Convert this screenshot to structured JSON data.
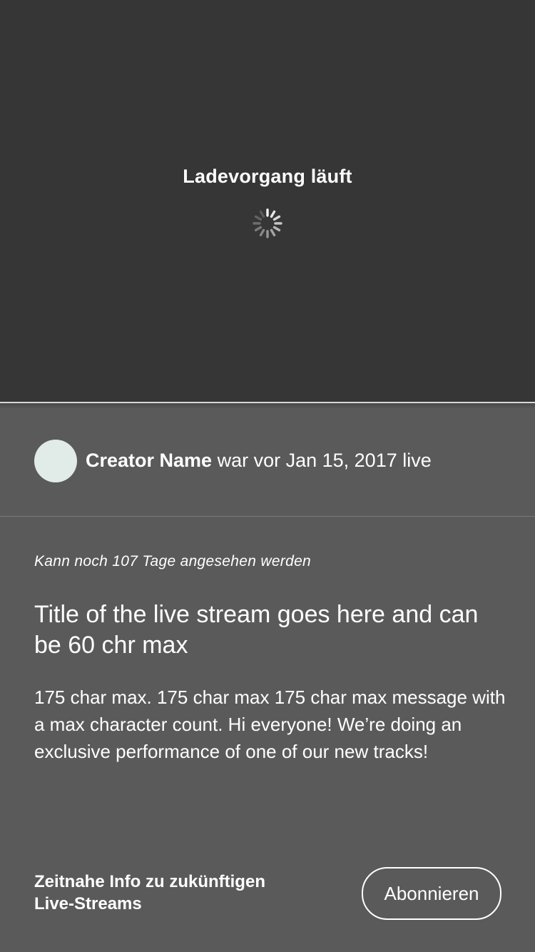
{
  "player": {
    "loading_text": "Ladevorgang läuft",
    "background_color": "#363636",
    "spinner_icon": "loading-spinner-icon"
  },
  "creator": {
    "name": "Creator Name",
    "status_text": " war vor Jan 15, 2017 live",
    "avatar_color": "#e1ebe8"
  },
  "stream": {
    "availability": "Kann noch 107 Tage angesehen werden",
    "title": "Title of the live stream goes here and can be 60 chr max",
    "description": "175 char max. 175 char max 175 char max message with a max character count. Hi everyone! We’re doing an exclusive performance of one of our new tracks!"
  },
  "subscribe": {
    "info_line1": "Zeitnahe Info zu zukünftigen",
    "info_line2": "Live-Streams",
    "button_label": "Abonnieren"
  }
}
